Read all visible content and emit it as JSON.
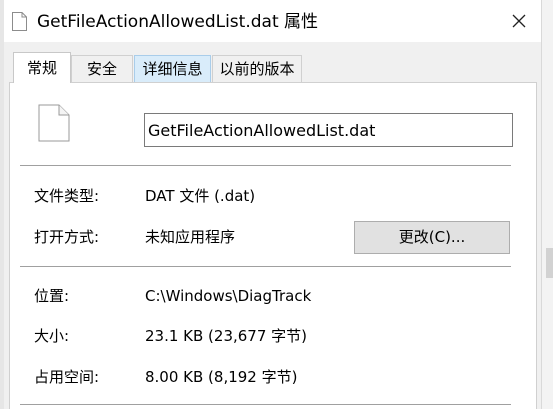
{
  "titlebar": {
    "title": "GetFileActionAllowedList.dat 属性",
    "close_icon": "close-icon"
  },
  "tabs": [
    {
      "label": "常规",
      "active": true
    },
    {
      "label": "安全",
      "active": false
    },
    {
      "label": "详细信息",
      "active": false
    },
    {
      "label": "以前的版本",
      "active": false
    }
  ],
  "general": {
    "file_name": "GetFileActionAllowedList.dat",
    "file_icon": "document-icon",
    "type_label": "文件类型:",
    "type_value": "DAT 文件 (.dat)",
    "opens_with_label": "打开方式:",
    "opens_with_value": "未知应用程序",
    "change_button": "更改(C)...",
    "location_label": "位置:",
    "location_value": "C:\\Windows\\DiagTrack",
    "size_label": "大小:",
    "size_value": "23.1 KB (23,677 字节)",
    "size_on_disk_label": "占用空间:",
    "size_on_disk_value": "8.00 KB (8,192 字节)"
  }
}
